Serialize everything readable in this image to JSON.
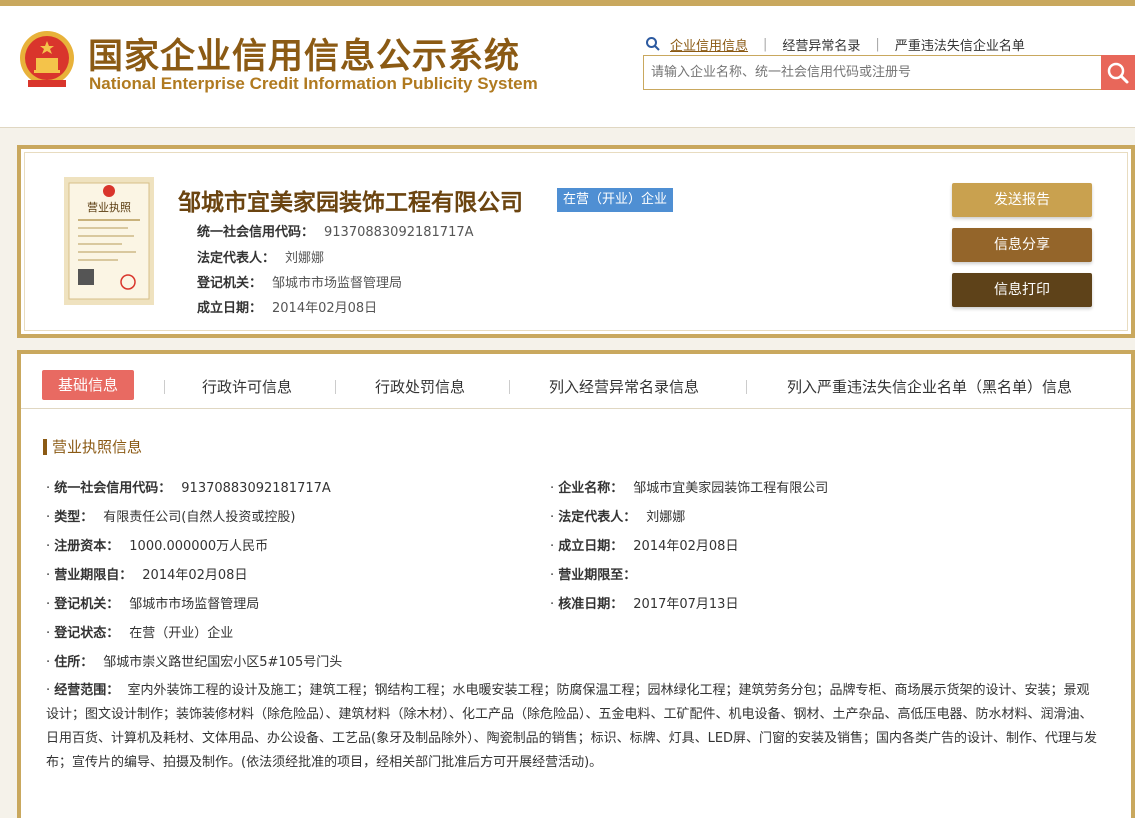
{
  "header": {
    "title_cn": "国家企业信用信息公示系统",
    "title_en": "National Enterprise Credit Information Publicity System",
    "links": [
      "企业信用信息",
      "经营异常名录",
      "严重违法失信企业名单"
    ],
    "search_placeholder": "请输入企业名称、统一社会信用代码或注册号"
  },
  "company": {
    "name": "邹城市宜美家园装饰工程有限公司",
    "status": "在营（开业）企业",
    "license_label": "营业执照",
    "credit_code_label": "统一社会信用代码：",
    "credit_code": "91370883092181717A",
    "legal_rep_label": "法定代表人：",
    "legal_rep": "刘娜娜",
    "authority_label": "登记机关：",
    "authority": "邹城市市场监督管理局",
    "founded_label": "成立日期：",
    "founded": "2014年02月08日"
  },
  "actions": {
    "send_report": "发送报告",
    "share": "信息分享",
    "print": "信息打印"
  },
  "tabs": [
    "基础信息",
    "行政许可信息",
    "行政处罚信息",
    "列入经营异常名录信息",
    "列入严重违法失信企业名单（黑名单）信息"
  ],
  "section_title": "营业执照信息",
  "fields": [
    {
      "label": "统一社会信用代码：",
      "value": "91370883092181717A"
    },
    {
      "label": "企业名称：",
      "value": "邹城市宜美家园装饰工程有限公司"
    },
    {
      "label": "类型：",
      "value": "有限责任公司(自然人投资或控股)"
    },
    {
      "label": "法定代表人：",
      "value": "刘娜娜"
    },
    {
      "label": "注册资本：",
      "value": "1000.000000万人民币"
    },
    {
      "label": "成立日期：",
      "value": "2014年02月08日"
    },
    {
      "label": "营业期限自：",
      "value": "2014年02月08日"
    },
    {
      "label": "营业期限至：",
      "value": ""
    },
    {
      "label": "登记机关：",
      "value": "邹城市市场监督管理局"
    },
    {
      "label": "核准日期：",
      "value": "2017年07月13日"
    },
    {
      "label": "登记状态：",
      "value": "在营（开业）企业"
    },
    {
      "label": "住所：",
      "value": "邹城市崇义路世纪国宏小区5#105号门头"
    }
  ],
  "scope": {
    "label": "经营范围：",
    "value": "室内外装饰工程的设计及施工；建筑工程；钢结构工程；水电暖安装工程；防腐保温工程；园林绿化工程；建筑劳务分包；品牌专柜、商场展示货架的设计、安装；景观设计；图文设计制作；装饰装修材料（除危险品）、建筑材料（除木材）、化工产品（除危险品）、五金电料、工矿配件、机电设备、钢材、土产杂品、高低压电器、防水材料、润滑油、日用百货、计算机及耗材、文体用品、办公设备、工艺品(象牙及制品除外）、陶瓷制品的销售；标识、标牌、灯具、LED屏、门窗的安装及销售；国内各类广告的设计、制作、代理与发布；宣传片的编导、拍摄及制作。(依法须经批准的项目，经相关部门批准后方可开展经营活动)。"
  }
}
